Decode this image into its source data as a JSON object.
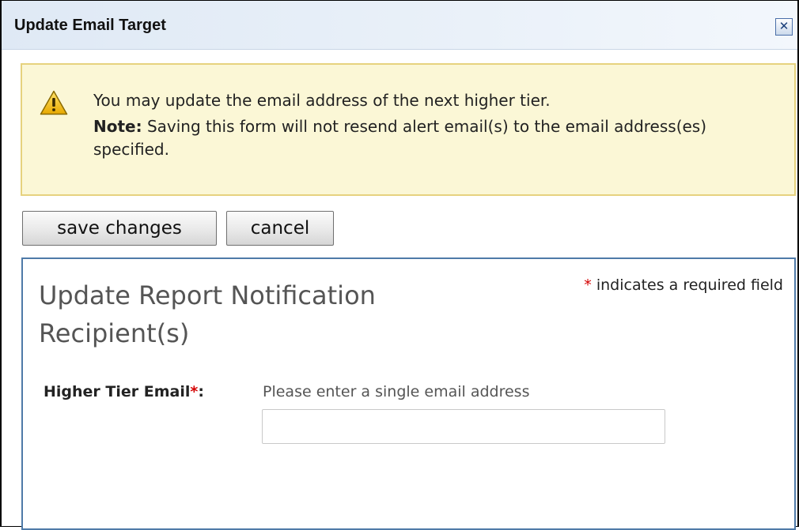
{
  "dialog": {
    "title": "Update Email Target",
    "close_glyph": "✕"
  },
  "alert": {
    "icon": "warning-triangle-icon",
    "line1": "You may update the email address of the next higher tier.",
    "note_label": "Note:",
    "note_text": " Saving this form will not resend alert email(s) to the email address(es) specified."
  },
  "toolbar": {
    "save_label": "save changes",
    "cancel_label": "cancel"
  },
  "form": {
    "title": "Update Report Notification Recipient(s)",
    "required_asterisk": "*",
    "required_note": " indicates a required field",
    "field_label": "Higher Tier Email",
    "field_colon": ":",
    "field_hint": "Please enter a single email address",
    "field_value": ""
  },
  "colors": {
    "alert_bg": "#fbf7d6",
    "alert_border": "#e6d27e",
    "panel_border": "#4f7aa8",
    "required": "#d40000"
  }
}
